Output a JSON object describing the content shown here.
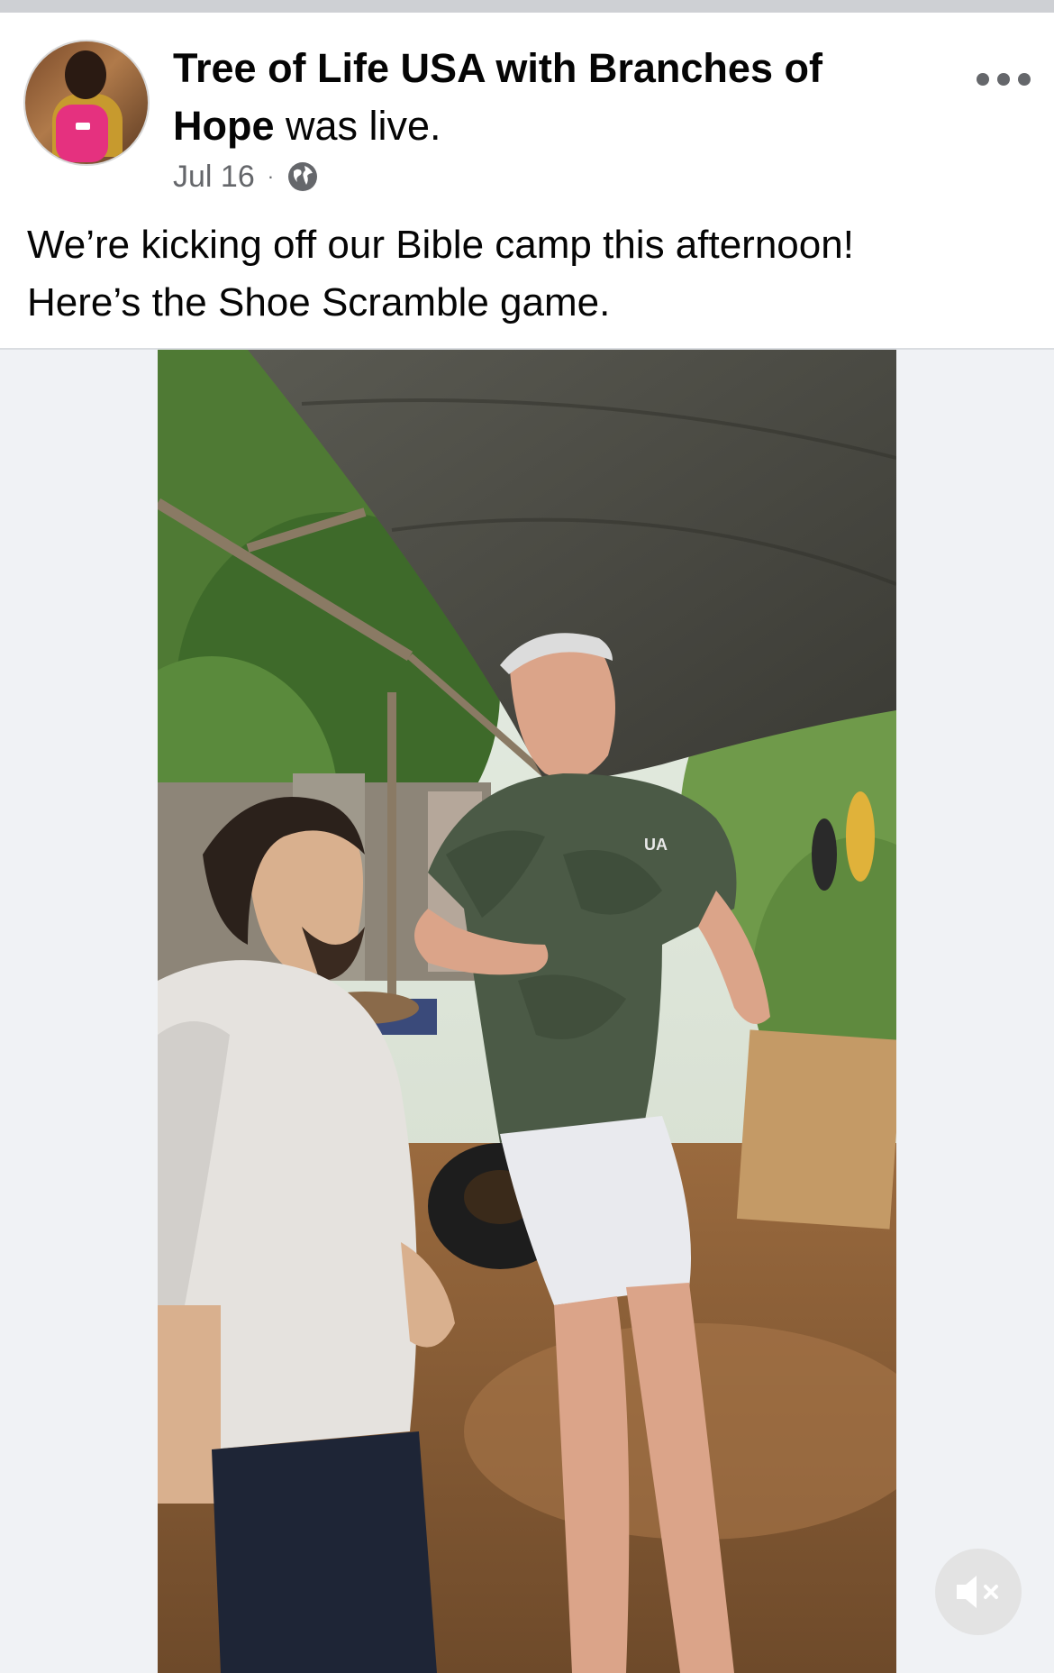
{
  "post": {
    "author_name": "Tree of Life USA with Branches of Hope",
    "status_suffix": " was live.",
    "date": "Jul 16",
    "separator": "·",
    "audience_icon": "globe-icon",
    "menu_icon": "more-horizontal-icon",
    "caption_line1": "We’re kicking off our Bible camp this afternoon!",
    "caption_line2": "Here’s the Shoe Scramble game."
  },
  "video": {
    "mute_icon": "speaker-muted-icon",
    "shirt_logo": "UA"
  }
}
